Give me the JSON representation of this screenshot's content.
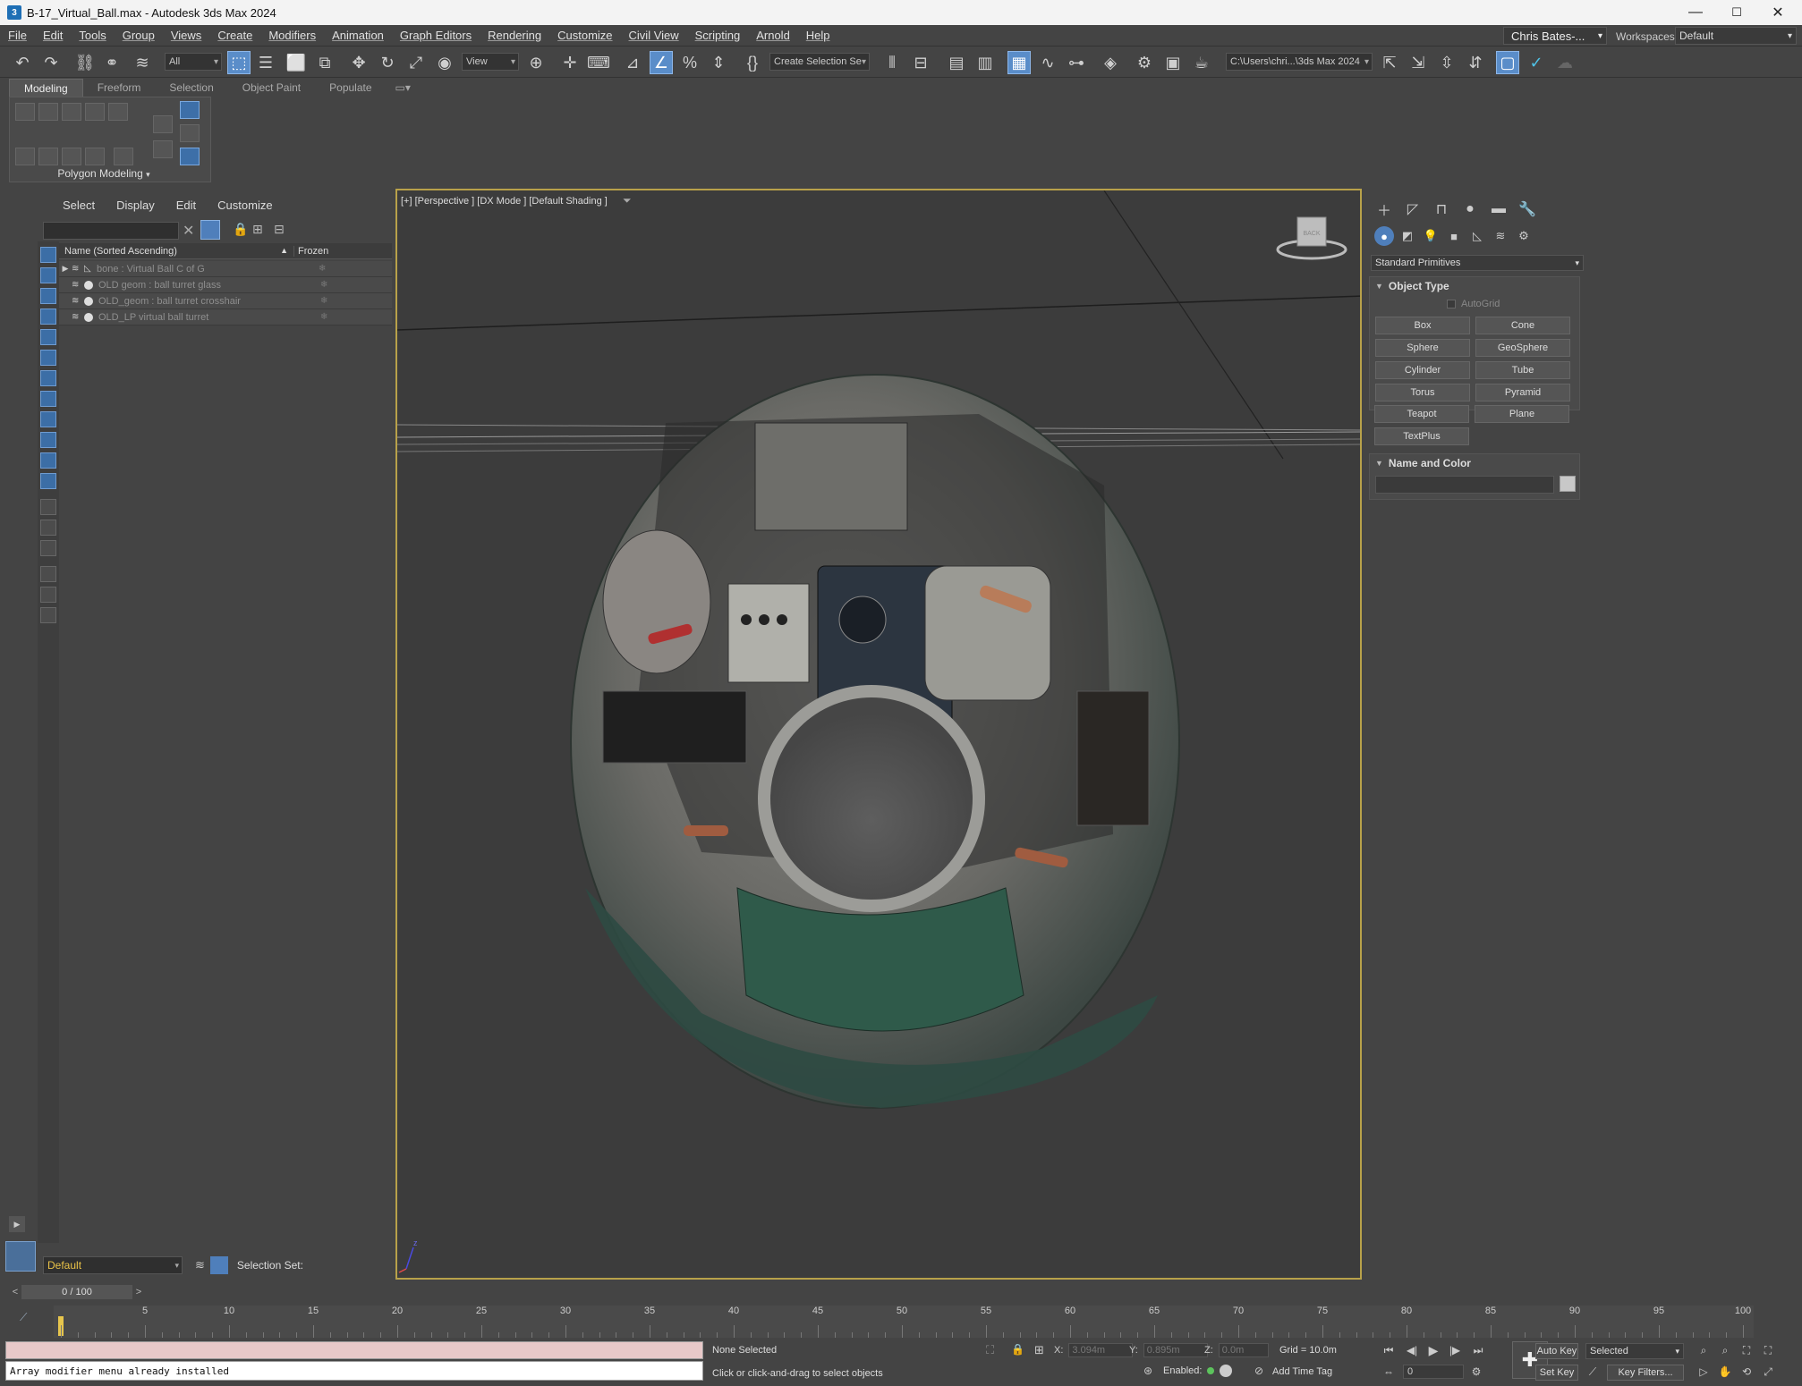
{
  "window": {
    "title": "B-17_Virtual_Ball.max - Autodesk 3ds Max 2024",
    "app_icon": "3",
    "minimize": "—",
    "maximize": "☐",
    "close": "✕"
  },
  "menu": [
    "File",
    "Edit",
    "Tools",
    "Group",
    "Views",
    "Create",
    "Modifiers",
    "Animation",
    "Graph Editors",
    "Rendering",
    "Customize",
    "Civil View",
    "Scripting",
    "Arnold",
    "Help"
  ],
  "account": {
    "user": "Chris Bates-...",
    "workspaces_label": "Workspaces:",
    "workspace": "Default"
  },
  "toolbar": {
    "selection_filter": "All",
    "ref_coord": "View",
    "named_selection": "Create Selection Se",
    "project_path": "C:\\Users\\chri...\\3ds Max 2024"
  },
  "ribbon": {
    "tabs": [
      "Modeling",
      "Freeform",
      "Selection",
      "Object Paint",
      "Populate"
    ],
    "active_tab": "Modeling",
    "panel_label": "Polygon Modeling"
  },
  "scene_explorer": {
    "menu": [
      "Select",
      "Display",
      "Edit",
      "Customize"
    ],
    "col_name": "Name (Sorted Ascending)",
    "col_sort": "▲",
    "col_frozen": "Frozen",
    "rows": [
      {
        "name": "bone : Virtual Ball C of G",
        "expandable": true
      },
      {
        "name": "OLD geom : ball turret glass",
        "expandable": false
      },
      {
        "name": "OLD_geom : ball turret crosshair",
        "expandable": false
      },
      {
        "name": "OLD_LP virtual ball turret",
        "expandable": false
      }
    ],
    "layer": "Default",
    "selection_set_label": "Selection Set:"
  },
  "viewport": {
    "label": "[+] [Perspective ] [DX Mode ] [Default Shading ]",
    "cube_label": "BACK"
  },
  "command_panel": {
    "category": "Standard Primitives",
    "object_type_title": "Object Type",
    "autogrid": "AutoGrid",
    "primitives": [
      "Box",
      "Cone",
      "Sphere",
      "GeoSphere",
      "Cylinder",
      "Tube",
      "Torus",
      "Pyramid",
      "Teapot",
      "Plane",
      "TextPlus"
    ],
    "name_color_title": "Name and Color",
    "object_color": "#c8c8c8"
  },
  "timeline": {
    "frame_display": "0 / 100",
    "ticks": [
      0,
      5,
      10,
      15,
      20,
      25,
      30,
      35,
      40,
      45,
      50,
      55,
      60,
      65,
      70,
      75,
      80,
      85,
      90,
      95,
      100
    ],
    "current_frame": 0
  },
  "status": {
    "listener_output": "Array modifier menu already installed",
    "selection": "None Selected",
    "prompt": "Click or click-and-drag to select objects",
    "x_label": "X:",
    "x_value": "3.094m",
    "y_label": "Y:",
    "y_value": "0.895m",
    "z_label": "Z:",
    "z_value": "0.0m",
    "grid": "Grid = 10.0m",
    "enabled": "Enabled:",
    "add_time_tag": "Add Time Tag",
    "frame_field": "0",
    "auto_key": "Auto Key",
    "set_key": "Set Key",
    "key_mode": "Selected",
    "key_filters": "Key Filters..."
  },
  "colors": {
    "viewport_border": "#b8a14a",
    "accent_blue": "#4f7fbb",
    "layer_text": "#e9c248"
  }
}
